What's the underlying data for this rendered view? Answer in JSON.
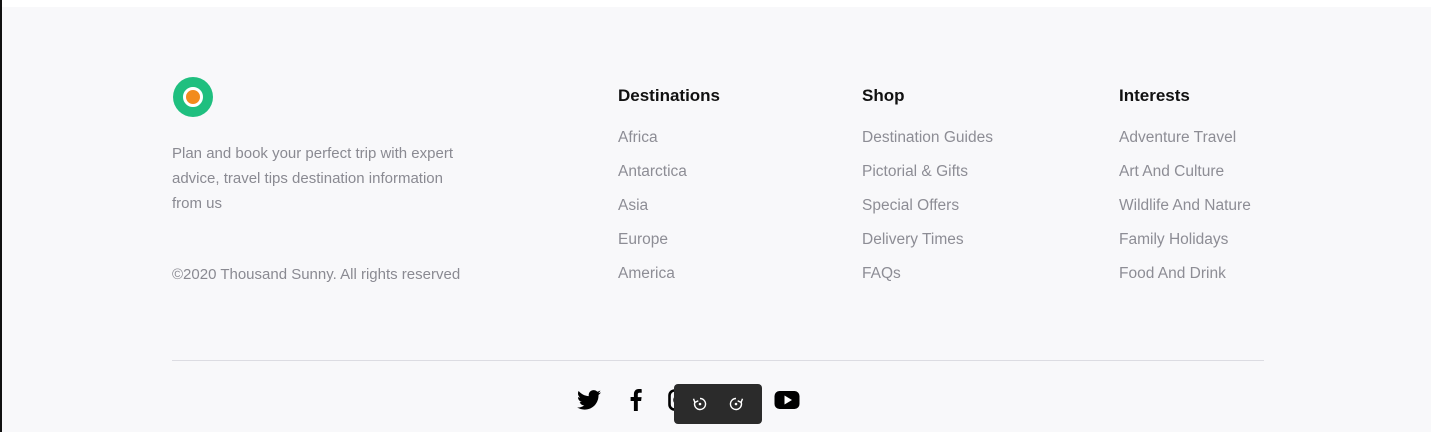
{
  "brand": {
    "tagline": "Plan and book your perfect trip with expert advice, travel tips destination information from us",
    "copyright": "©2020 Thousand Sunny. All rights reserved",
    "logo_colors": {
      "outer": "#1fbf7f",
      "inner": "#f28b1d"
    }
  },
  "columns": [
    {
      "title": "Destinations",
      "items": [
        "Africa",
        "Antarctica",
        "Asia",
        "Europe",
        "America"
      ]
    },
    {
      "title": "Shop",
      "items": [
        "Destination Guides",
        "Pictorial & Gifts",
        "Special Offers",
        "Delivery Times",
        "FAQs"
      ]
    },
    {
      "title": "Interests",
      "items": [
        "Adventure Travel",
        "Art And Culture",
        "Wildlife And Nature",
        "Family Holidays",
        "Food And Drink"
      ]
    }
  ],
  "social": [
    "twitter-icon",
    "facebook-icon",
    "instagram-icon",
    "youtube-icon"
  ],
  "media_controls": [
    "rewind-icon",
    "forward-icon"
  ]
}
